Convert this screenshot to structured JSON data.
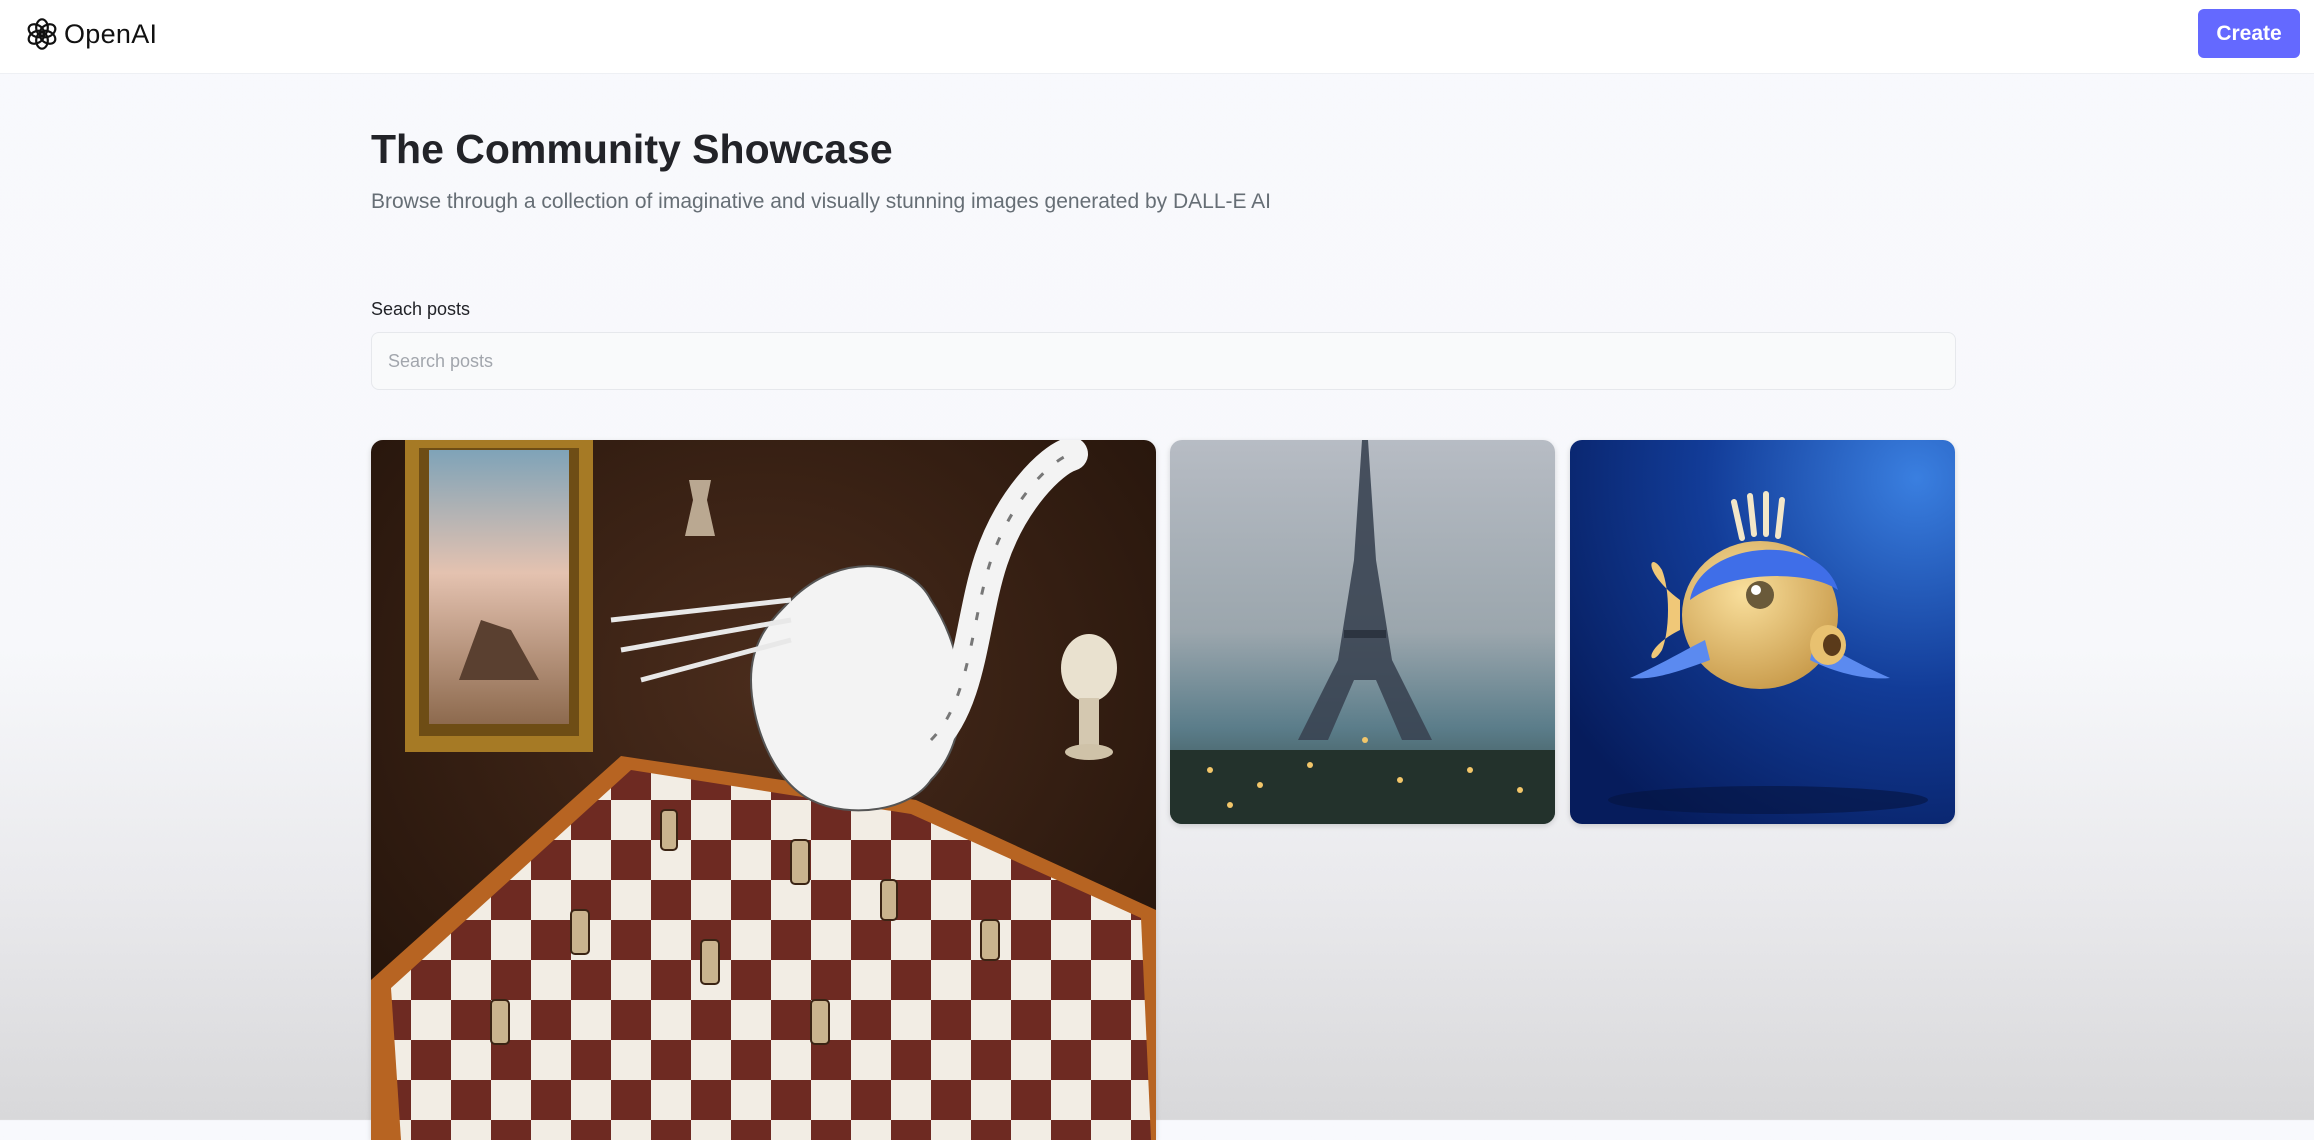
{
  "header": {
    "logo_text": "OpenAI",
    "logo_icon": "openai-logo-icon",
    "create_label": "Create",
    "accent_color": "#6469ff"
  },
  "main": {
    "title": "The Community Showcase",
    "subtitle": "Browse through a collection of imaginative and visually stunning images generated by DALL-E AI",
    "search": {
      "label": "Seach posts",
      "placeholder": "Search posts",
      "value": ""
    },
    "gallery": {
      "items": [
        {
          "subject": "white cat over a chessboard, oil painting"
        },
        {
          "subject": "eiffel tower, impressionist painting"
        },
        {
          "subject": "3d cartoon pufferfish on blue background"
        }
      ]
    }
  }
}
